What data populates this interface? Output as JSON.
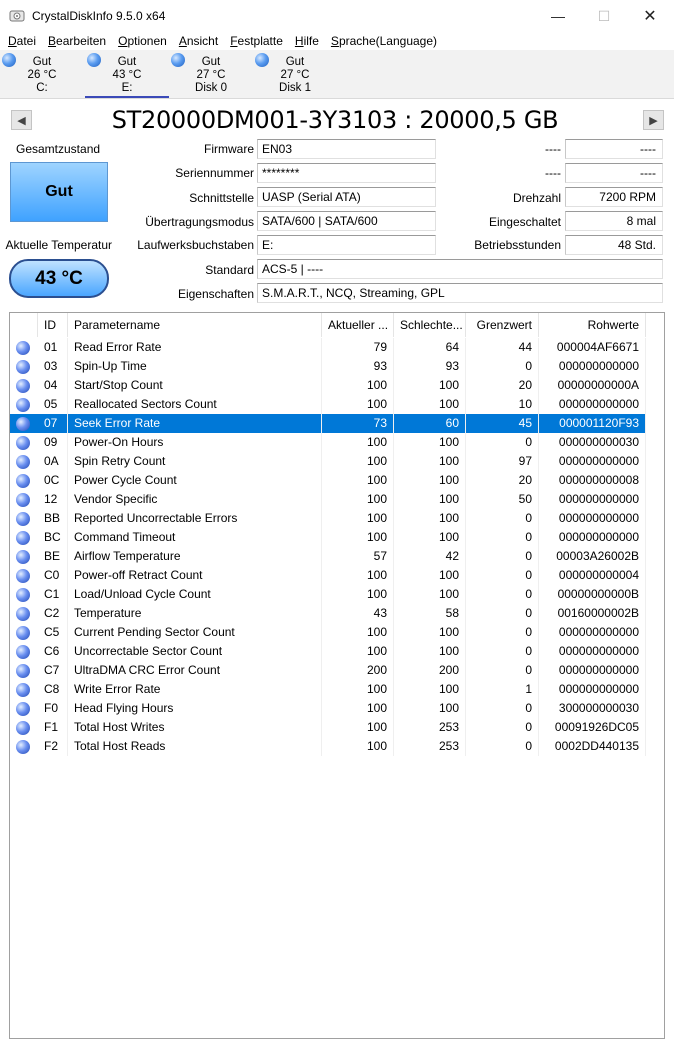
{
  "window": {
    "title": "CrystalDiskInfo 9.5.0 x64",
    "minimize": "—",
    "maximize": "☐",
    "close": "✕"
  },
  "menu": [
    {
      "mnemonic": "D",
      "rest": "atei"
    },
    {
      "mnemonic": "B",
      "rest": "earbeiten"
    },
    {
      "mnemonic": "O",
      "rest": "ptionen"
    },
    {
      "mnemonic": "A",
      "rest": "nsicht"
    },
    {
      "mnemonic": "F",
      "rest": "estplatte"
    },
    {
      "mnemonic": "H",
      "rest": "ilfe"
    },
    {
      "mnemonic": "S",
      "rest": "prache(Language)"
    }
  ],
  "disks": [
    {
      "status": "Gut",
      "temp": "26 °C",
      "name": "C:"
    },
    {
      "status": "Gut",
      "temp": "43 °C",
      "name": "E:"
    },
    {
      "status": "Gut",
      "temp": "27 °C",
      "name": "Disk 0"
    },
    {
      "status": "Gut",
      "temp": "27 °C",
      "name": "Disk 1"
    }
  ],
  "nav": {
    "prev": "◀",
    "next": "▶"
  },
  "drive": {
    "model": "ST20000DM001-3Y3103 : 20000,5 GB",
    "health_label": "Gesamtzustand",
    "health": "Gut",
    "temp_label": "Aktuelle Temperatur",
    "temp": "43 °C"
  },
  "info": {
    "firmware": {
      "label": "Firmware",
      "value": "EN03"
    },
    "serial": {
      "label": "Seriennummer",
      "value": "********"
    },
    "interface": {
      "label": "Schnittstelle",
      "value": "UASP (Serial ATA)"
    },
    "transfer": {
      "label": "Übertragungsmodus",
      "value": "SATA/600 | SATA/600"
    },
    "letter": {
      "label": "Laufwerksbuchstaben",
      "value": "E:"
    },
    "standard": {
      "label": "Standard",
      "value": "ACS-5 | ----"
    },
    "features": {
      "label": "Eigenschaften",
      "value": "S.M.A.R.T., NCQ, Streaming, GPL"
    },
    "right_top_label": "----",
    "right_top_value": "----",
    "right_2_label": "----",
    "right_2_value": "----",
    "rpm": {
      "label": "Drehzahl",
      "value": "7200 RPM"
    },
    "power_count": {
      "label": "Eingeschaltet",
      "value": "8 mal"
    },
    "power_hours": {
      "label": "Betriebsstunden",
      "value": "48 Std."
    }
  },
  "smart": {
    "headers": {
      "id": "ID",
      "name": "Parametername",
      "current": "Aktueller ...",
      "worst": "Schlechte...",
      "threshold": "Grenzwert",
      "raw": "Rohwerte"
    },
    "rows": [
      {
        "id": "01",
        "name": "Read Error Rate",
        "current": "79",
        "worst": "64",
        "threshold": "44",
        "raw": "000004AF6671"
      },
      {
        "id": "03",
        "name": "Spin-Up Time",
        "current": "93",
        "worst": "93",
        "threshold": "0",
        "raw": "000000000000"
      },
      {
        "id": "04",
        "name": "Start/Stop Count",
        "current": "100",
        "worst": "100",
        "threshold": "20",
        "raw": "00000000000A"
      },
      {
        "id": "05",
        "name": "Reallocated Sectors Count",
        "current": "100",
        "worst": "100",
        "threshold": "10",
        "raw": "000000000000"
      },
      {
        "id": "07",
        "name": "Seek Error Rate",
        "current": "73",
        "worst": "60",
        "threshold": "45",
        "raw": "000001120F93"
      },
      {
        "id": "09",
        "name": "Power-On Hours",
        "current": "100",
        "worst": "100",
        "threshold": "0",
        "raw": "000000000030"
      },
      {
        "id": "0A",
        "name": "Spin Retry Count",
        "current": "100",
        "worst": "100",
        "threshold": "97",
        "raw": "000000000000"
      },
      {
        "id": "0C",
        "name": "Power Cycle Count",
        "current": "100",
        "worst": "100",
        "threshold": "20",
        "raw": "000000000008"
      },
      {
        "id": "12",
        "name": "Vendor Specific",
        "current": "100",
        "worst": "100",
        "threshold": "50",
        "raw": "000000000000"
      },
      {
        "id": "BB",
        "name": "Reported Uncorrectable Errors",
        "current": "100",
        "worst": "100",
        "threshold": "0",
        "raw": "000000000000"
      },
      {
        "id": "BC",
        "name": "Command Timeout",
        "current": "100",
        "worst": "100",
        "threshold": "0",
        "raw": "000000000000"
      },
      {
        "id": "BE",
        "name": "Airflow Temperature",
        "current": "57",
        "worst": "42",
        "threshold": "0",
        "raw": "00003A26002B"
      },
      {
        "id": "C0",
        "name": "Power-off Retract Count",
        "current": "100",
        "worst": "100",
        "threshold": "0",
        "raw": "000000000004"
      },
      {
        "id": "C1",
        "name": "Load/Unload Cycle Count",
        "current": "100",
        "worst": "100",
        "threshold": "0",
        "raw": "00000000000B"
      },
      {
        "id": "C2",
        "name": "Temperature",
        "current": "43",
        "worst": "58",
        "threshold": "0",
        "raw": "00160000002B"
      },
      {
        "id": "C5",
        "name": "Current Pending Sector Count",
        "current": "100",
        "worst": "100",
        "threshold": "0",
        "raw": "000000000000"
      },
      {
        "id": "C6",
        "name": "Uncorrectable Sector Count",
        "current": "100",
        "worst": "100",
        "threshold": "0",
        "raw": "000000000000"
      },
      {
        "id": "C7",
        "name": "UltraDMA CRC Error Count",
        "current": "200",
        "worst": "200",
        "threshold": "0",
        "raw": "000000000000"
      },
      {
        "id": "C8",
        "name": "Write Error Rate",
        "current": "100",
        "worst": "100",
        "threshold": "1",
        "raw": "000000000000"
      },
      {
        "id": "F0",
        "name": "Head Flying Hours",
        "current": "100",
        "worst": "100",
        "threshold": "0",
        "raw": "300000000030"
      },
      {
        "id": "F1",
        "name": "Total Host Writes",
        "current": "100",
        "worst": "253",
        "threshold": "0",
        "raw": "00091926DC05"
      },
      {
        "id": "F2",
        "name": "Total Host Reads",
        "current": "100",
        "worst": "253",
        "threshold": "0",
        "raw": "0002DD440135"
      }
    ],
    "selected_id": "07"
  }
}
